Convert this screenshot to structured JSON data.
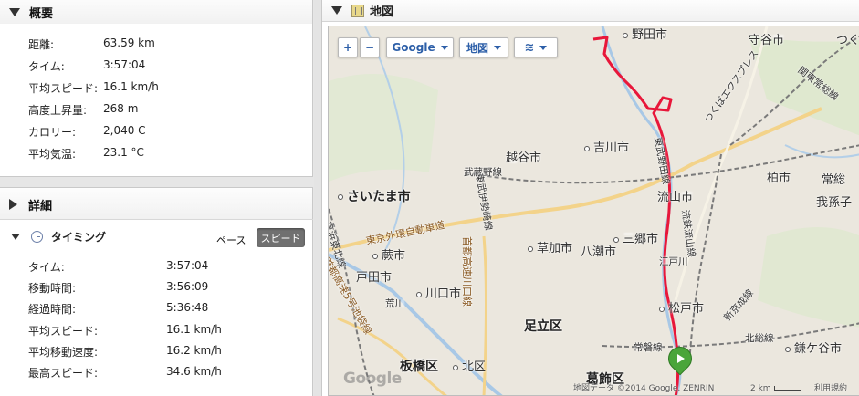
{
  "summary": {
    "title": "概要",
    "rows": [
      {
        "label": "距離:",
        "value": "63.59 km"
      },
      {
        "label": "タイム:",
        "value": "3:57:04"
      },
      {
        "label": "平均スピード:",
        "value": "16.1 km/h"
      },
      {
        "label": "高度上昇量:",
        "value": "268 m"
      },
      {
        "label": "カロリー:",
        "value": "2,040 C"
      },
      {
        "label": "平均気温:",
        "value": "23.1 °C"
      }
    ]
  },
  "details": {
    "title": "詳細",
    "timing": {
      "title": "タイミング",
      "pace_label": "ペース",
      "speed_label": "スピード",
      "rows": [
        {
          "label": "タイム:",
          "value": "3:57:04"
        },
        {
          "label": "移動時間:",
          "value": "3:56:09"
        },
        {
          "label": "経過時間:",
          "value": "5:36:48"
        },
        {
          "label": "平均スピード:",
          "value": "16.1 km/h"
        },
        {
          "label": "平均移動速度:",
          "value": "16.2 km/h"
        },
        {
          "label": "最高スピード:",
          "value": "34.6 km/h"
        }
      ]
    }
  },
  "map": {
    "title": "地図",
    "controls": {
      "zoom_in": "+",
      "zoom_out": "−",
      "provider": "Google",
      "map_type": "地図"
    },
    "labels": {
      "noda": "野田市",
      "moriya": "守谷市",
      "tsukuba": "つく",
      "joban_line": "関東常総線",
      "yoshikawa": "吉川市",
      "koshigaya": "越谷市",
      "tobu_noda": "東武野田線",
      "tsukuba_express": "つくばエクスプレス",
      "musashino": "武蔵野線",
      "saitama": "さいたま市",
      "nagareyama": "流山市",
      "kashiwa": "柏市",
      "joso": "常総",
      "abiko": "我孫子",
      "gaikan": "東京外環自動車道",
      "keihin_tohoku": "京浜東北線",
      "sangou": "三郷市",
      "warabi": "蕨市",
      "soka": "草加市",
      "yashio": "八潮市",
      "toda": "戸田市",
      "edogawa": "江戸川",
      "kawaguchi": "川口市",
      "adachi": "足立区",
      "matsudo": "松戸市",
      "shinkeisei": "新京成線",
      "joban_sen": "常磐線",
      "hokuso": "北総線",
      "kamagaya": "鎌ケ谷市",
      "itabashi": "板橋区",
      "kita": "北区",
      "katsushika": "葛飾区",
      "arakawa": "荒川",
      "route5": "首都高速5号池袋線",
      "ryutetsu": "流鉄流山線",
      "kitanagareyama": "東武伊勢崎線",
      "route_saitama": "首都高速川口線"
    },
    "footer": {
      "data": "地図データ ©2014 Google, ZENRIN",
      "scale": "2 km",
      "terms": "利用規約"
    },
    "watermark": "Google",
    "colors": {
      "route": "#e8173a",
      "start_marker": "#4aa53a"
    }
  }
}
